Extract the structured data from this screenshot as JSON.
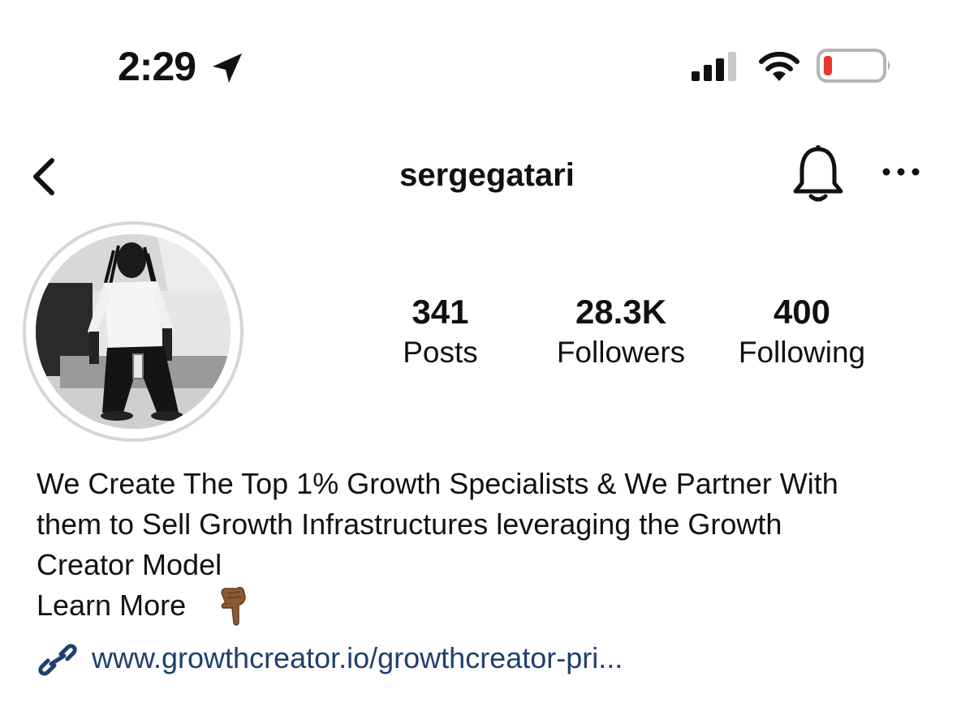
{
  "status_bar": {
    "time": "2:29",
    "icons": [
      "location-arrow-icon",
      "signal-icon",
      "wifi-icon",
      "battery-low-icon"
    ],
    "battery_color": "#e8372c"
  },
  "header": {
    "username": "sergegatari",
    "icons": [
      "back-chevron-icon",
      "bell-icon",
      "more-icon"
    ]
  },
  "profile": {
    "stats": [
      {
        "value": "341",
        "label": "Posts"
      },
      {
        "value": "28.3K",
        "label": "Followers"
      },
      {
        "value": "400",
        "label": "Following"
      }
    ],
    "bio": {
      "lines": [
        "We Create The Top 1% Growth Specialists & We Partner With",
        "them to Sell Growth Infrastructures leveraging the Growth",
        "Creator Model"
      ],
      "learn_more": "Learn More",
      "emoji_icon": "backhand-index-pointing-down-icon"
    },
    "link": {
      "text": "www.growthcreator.io/growthcreator-pri...",
      "icon": "link-icon",
      "color": "#1f3f6f"
    }
  }
}
